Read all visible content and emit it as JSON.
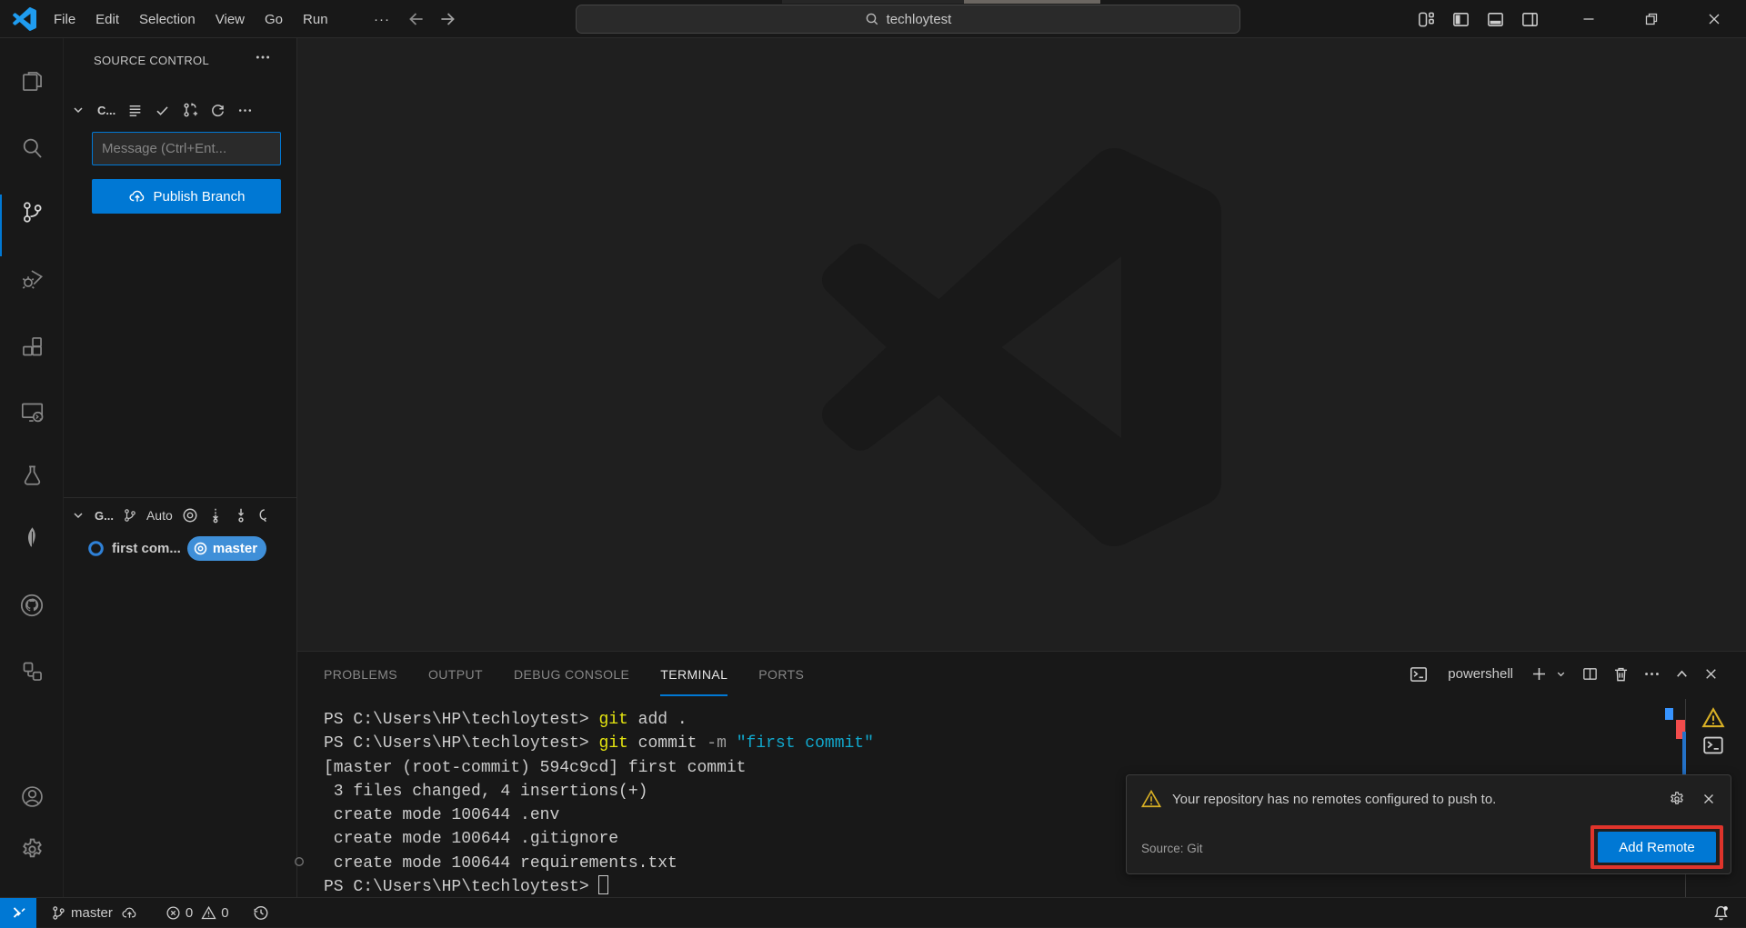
{
  "title_bar": {
    "menus": [
      "File",
      "Edit",
      "Selection",
      "View",
      "Go",
      "Run"
    ],
    "more_label": "···",
    "search_text": "techloytest"
  },
  "activity_bar": {
    "items": [
      "explorer",
      "search",
      "source-control",
      "run-and-debug",
      "extensions",
      "remote-explorer",
      "testing",
      "mongodb",
      "github",
      "references",
      "accounts",
      "settings"
    ],
    "active_item": "source-control"
  },
  "source_control": {
    "title": "SOURCE CONTROL",
    "section_label": "C...",
    "message_placeholder": "Message (Ctrl+Ent...",
    "publish_label": "Publish Branch",
    "graph_label": "G...",
    "graph_auto_label": "Auto",
    "commit_label": "first com...",
    "branch_badge": "master"
  },
  "panel": {
    "tabs": [
      {
        "label": "PROBLEMS",
        "active": false
      },
      {
        "label": "OUTPUT",
        "active": false
      },
      {
        "label": "DEBUG CONSOLE",
        "active": false
      },
      {
        "label": "TERMINAL",
        "active": true
      },
      {
        "label": "PORTS",
        "active": false
      }
    ],
    "terminal": {
      "name": "powershell",
      "lines": [
        [
          {
            "t": "PS C:\\Users\\HP\\techloytest> ",
            "c": "fg"
          },
          {
            "t": "git",
            "c": "yellow"
          },
          {
            "t": " add .",
            "c": "fg"
          }
        ],
        [
          {
            "t": "PS C:\\Users\\HP\\techloytest> ",
            "c": "fg"
          },
          {
            "t": "git",
            "c": "yellow"
          },
          {
            "t": " commit ",
            "c": "fg"
          },
          {
            "t": "-m ",
            "c": "gray"
          },
          {
            "t": "\"first commit\"",
            "c": "cyan"
          }
        ],
        [
          {
            "t": "[master (root-commit) 594c9cd] first commit",
            "c": "fg"
          }
        ],
        [
          {
            "t": " 3 files changed, 4 insertions(+)",
            "c": "fg"
          }
        ],
        [
          {
            "t": " create mode 100644 .env",
            "c": "fg"
          }
        ],
        [
          {
            "t": " create mode 100644 .gitignore",
            "c": "fg"
          }
        ],
        [
          {
            "t": " create mode 100644 requirements.txt",
            "c": "fg"
          }
        ],
        [
          {
            "t": "PS C:\\Users\\HP\\techloytest> ",
            "c": "fg"
          },
          {
            "t": "",
            "c": "cursor"
          }
        ]
      ]
    }
  },
  "notification": {
    "message": "Your repository has no remotes configured to push to.",
    "source": "Source: Git",
    "action_label": "Add Remote"
  },
  "status_bar": {
    "branch": "master",
    "errors": "0",
    "warnings": "0"
  },
  "colors": {
    "accent": "#0078d4",
    "badge_blue": "#3f8fd8",
    "warning_yellow": "#d8b025",
    "annotation_red": "#e0342b",
    "terminal_yellow": "#e5e510",
    "terminal_cyan": "#11a8cd",
    "terminal_param_gray": "#9b9b9b",
    "error_red": "#f14c4c"
  }
}
